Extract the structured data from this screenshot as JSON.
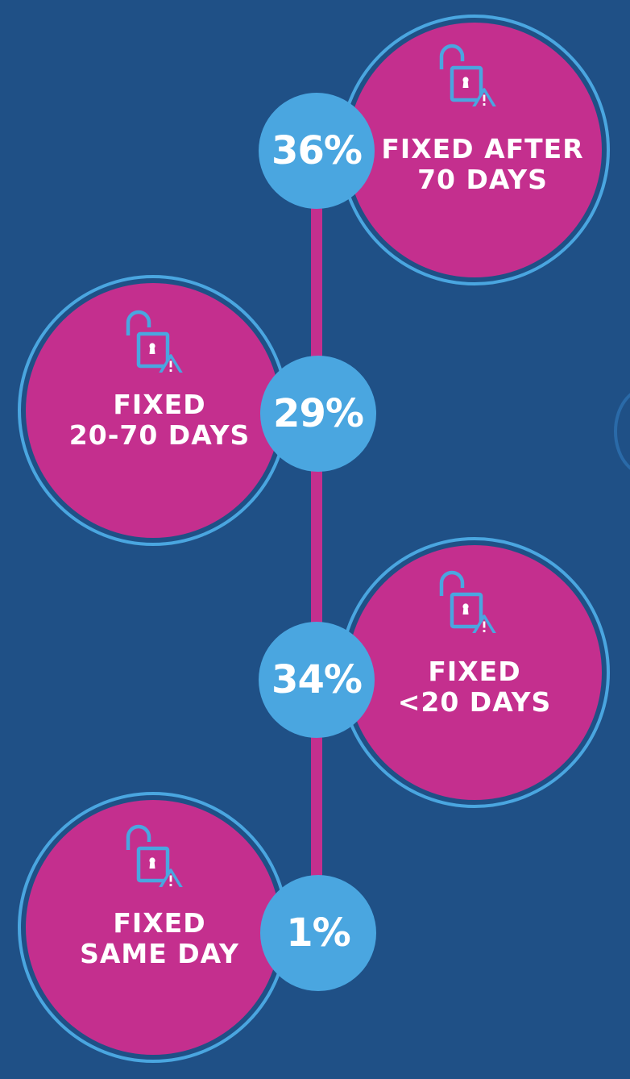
{
  "colors": {
    "background": "#1f5086",
    "disc": "#c42f8e",
    "accent": "#4aa6e0",
    "connector": "#c42f8e",
    "text": "#ffffff"
  },
  "icon_name": "unlocked-padlock-warning-icon",
  "items": [
    {
      "percent": "36%",
      "line1": "FIXED AFTER",
      "line2": "70 DAYS"
    },
    {
      "percent": "29%",
      "line1": "FIXED",
      "line2": "20-70 DAYS"
    },
    {
      "percent": "34%",
      "line1": "FIXED",
      "line2": "<20 DAYS"
    },
    {
      "percent": "1%",
      "line1": "FIXED",
      "line2": "SAME DAY"
    }
  ]
}
